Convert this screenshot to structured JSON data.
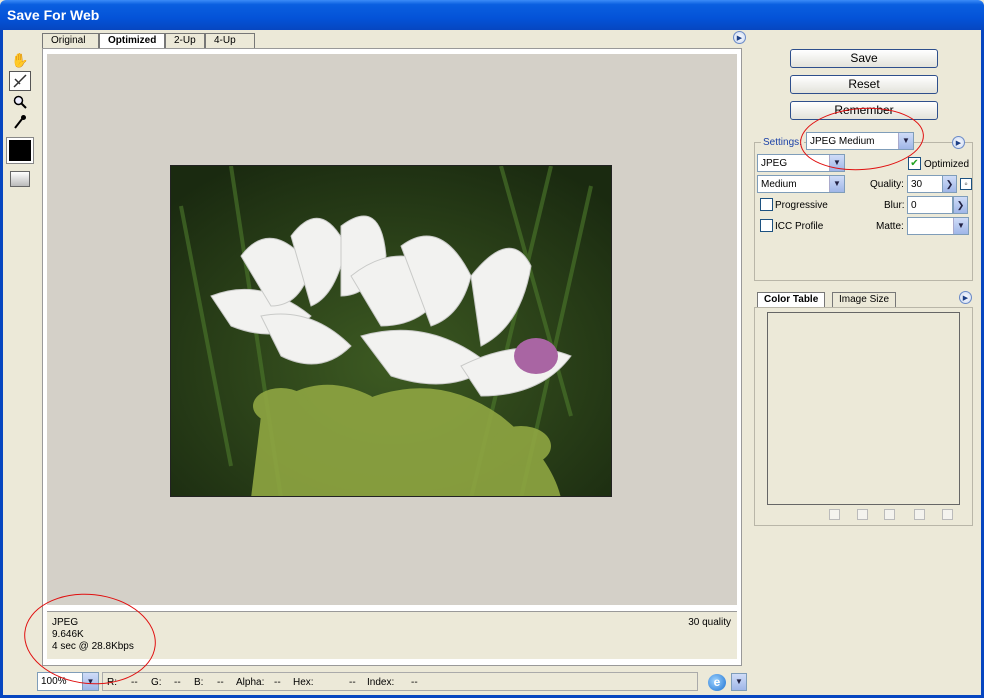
{
  "window": {
    "title": "Save For Web"
  },
  "tabs": [
    {
      "label": "Original"
    },
    {
      "label": "Optimized"
    },
    {
      "label": "2-Up"
    },
    {
      "label": "4-Up"
    }
  ],
  "info": {
    "format": "JPEG",
    "size": "9.646K",
    "time": "4 sec @ 28.8Kbps",
    "quality_text": "30 quality"
  },
  "statusbar": {
    "zoom": "100%",
    "r_label": "R:",
    "r_value": "--",
    "g_label": "G:",
    "g_value": "--",
    "b_label": "B:",
    "b_value": "--",
    "alpha_label": "Alpha:",
    "alpha_value": "--",
    "hex_label": "Hex:",
    "hex_value": "--",
    "index_label": "Index:",
    "index_value": "--"
  },
  "buttons": {
    "save": "Save",
    "reset": "Reset",
    "remember": "Remember"
  },
  "settings": {
    "label": "Settings:",
    "preset": "JPEG Medium",
    "format": "JPEG",
    "optimized_label": "Optimized",
    "optimized_checked": true,
    "quality_preset": "Medium",
    "quality_label": "Quality:",
    "quality_value": "30",
    "progressive_label": "Progressive",
    "blur_label": "Blur:",
    "blur_value": "0",
    "icc_label": "ICC Profile",
    "matte_label": "Matte:",
    "matte_value": ""
  },
  "panel_tabs": [
    {
      "label": "Color Table"
    },
    {
      "label": "Image Size"
    }
  ],
  "icons": {
    "hand": "hand-icon",
    "slice": "slice-select-icon",
    "zoom": "zoom-icon",
    "eyedropper": "eyedropper-icon",
    "browser": "browser-preview-icon"
  },
  "colors": {
    "annotation": "#e01010",
    "titlebar": "#0453d8"
  }
}
